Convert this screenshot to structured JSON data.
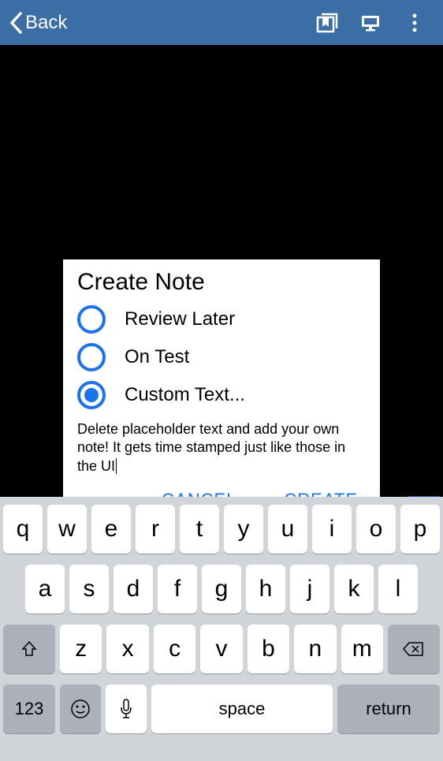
{
  "header": {
    "back_label": "Back"
  },
  "dialog": {
    "title": "Create Note",
    "options": [
      {
        "label": "Review Later",
        "selected": false
      },
      {
        "label": "On Test",
        "selected": false
      },
      {
        "label": "Custom Text...",
        "selected": true
      }
    ],
    "note_text": "Delete placeholder text and add your own note! It gets time stamped just like those in the UI",
    "cancel_label": "CANCEL",
    "create_label": "CREATE"
  },
  "keyboard": {
    "row1": [
      "q",
      "w",
      "e",
      "r",
      "t",
      "y",
      "u",
      "i",
      "o",
      "p"
    ],
    "row2": [
      "a",
      "s",
      "d",
      "f",
      "g",
      "h",
      "j",
      "k",
      "l"
    ],
    "row3": [
      "z",
      "x",
      "c",
      "v",
      "b",
      "n",
      "m"
    ],
    "num_label": "123",
    "space_label": "space",
    "return_label": "return"
  }
}
